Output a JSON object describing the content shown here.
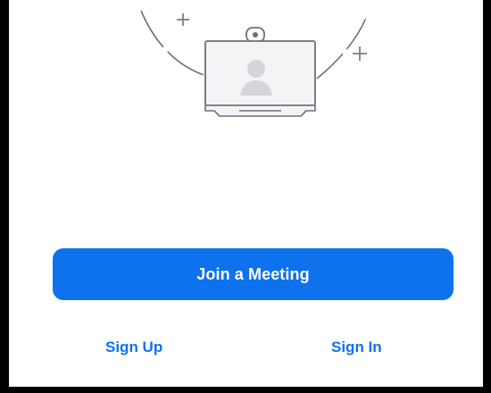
{
  "actions": {
    "join_label": "Join a Meeting",
    "signup_label": "Sign Up",
    "signin_label": "Sign In"
  },
  "illustration": {
    "icon": "video-conference-device-icon",
    "plus_marks": 2
  },
  "colors": {
    "accent": "#0e72ed",
    "background": "#ffffff",
    "frame": "#000000",
    "illustration_stroke": "#6e6e78",
    "illustration_fill": "#f4f4f6",
    "avatar_fill": "#d5d5db"
  }
}
